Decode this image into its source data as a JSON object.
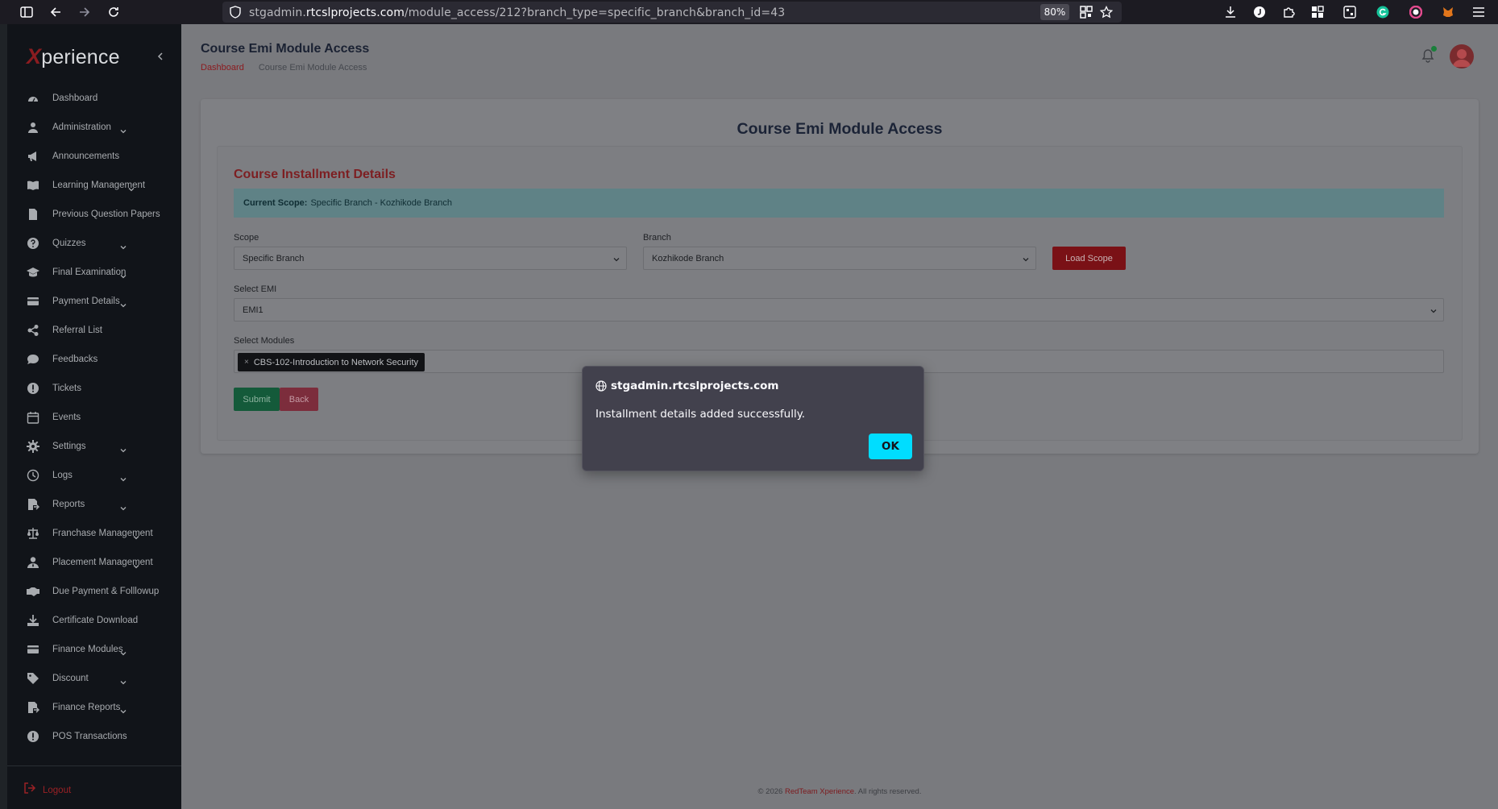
{
  "browser": {
    "url_prefix": "stgadmin.",
    "url_domain": "rtcslprojects.com",
    "url_path": "/module_access/212?branch_type=specific_branch&branch_id=43",
    "zoom": "80%"
  },
  "sidebar": {
    "logo_x": "X",
    "logo_rest": "perience",
    "items": [
      {
        "label": "Dashboard",
        "icon": "dashboard-icon",
        "has_caret": false
      },
      {
        "label": "Administration",
        "icon": "user-icon",
        "has_caret": true
      },
      {
        "label": "Announcements",
        "icon": "megaphone-icon",
        "has_caret": false
      },
      {
        "label": "Learning Management",
        "icon": "book-icon",
        "has_caret": true
      },
      {
        "label": "Previous Question Papers",
        "icon": "file-icon",
        "has_caret": false
      },
      {
        "label": "Quizzes",
        "icon": "question-icon",
        "has_caret": true
      },
      {
        "label": "Final Examination",
        "icon": "graduation-cap-icon",
        "has_caret": true
      },
      {
        "label": "Payment Details",
        "icon": "credit-card-icon",
        "has_caret": true
      },
      {
        "label": "Referral List",
        "icon": "share-icon",
        "has_caret": false
      },
      {
        "label": "Feedbacks",
        "icon": "comment-icon",
        "has_caret": false
      },
      {
        "label": "Tickets",
        "icon": "alert-icon",
        "has_caret": false
      },
      {
        "label": "Events",
        "icon": "calendar-icon",
        "has_caret": false
      },
      {
        "label": "Settings",
        "icon": "gear-icon",
        "has_caret": true
      },
      {
        "label": "Logs",
        "icon": "clock-icon",
        "has_caret": true
      },
      {
        "label": "Reports",
        "icon": "report-icon",
        "has_caret": true
      },
      {
        "label": "Franchase Management",
        "icon": "scale-icon",
        "has_caret": true
      },
      {
        "label": "Placement Management",
        "icon": "user-tie-icon",
        "has_caret": true
      },
      {
        "label": "Due Payment & Folllowup",
        "icon": "handshake-icon",
        "has_caret": false
      },
      {
        "label": "Certificate Download",
        "icon": "download-icon",
        "has_caret": false
      },
      {
        "label": "Finance Modules",
        "icon": "credit-card-icon",
        "has_caret": true
      },
      {
        "label": "Discount",
        "icon": "tag-icon",
        "has_caret": true
      },
      {
        "label": "Finance Reports",
        "icon": "report-icon",
        "has_caret": true
      },
      {
        "label": "POS Transactions",
        "icon": "alert-icon",
        "has_caret": false
      }
    ],
    "logout_label": "Logout"
  },
  "header": {
    "title": "Course Emi Module Access",
    "breadcrumb": {
      "home": "Dashboard",
      "current": "Course Emi Module Access"
    }
  },
  "main": {
    "card_title": "Course Emi Module Access",
    "section_title": "Course Installment Details",
    "scope_banner": {
      "label": "Current Scope:",
      "value": "Specific Branch - Kozhikode Branch"
    },
    "scope_label": "Scope",
    "scope_value": "Specific Branch",
    "branch_label": "Branch",
    "branch_value": "Kozhikode Branch",
    "load_scope_label": "Load Scope",
    "emi_label": "Select EMI",
    "emi_value": "EMI1",
    "modules_label": "Select Modules",
    "selected_modules": [
      "CBS-102-Introduction to Network Security"
    ],
    "remove_glyph": "×",
    "submit_label": "Submit",
    "back_label": "Back"
  },
  "footer": {
    "prefix": "© 2026 ",
    "brand": "RedTeam Xperience",
    "suffix": ". All rights reserved."
  },
  "dialog": {
    "origin": "stgadmin.rtcslprojects.com",
    "message": "Installment details added successfully.",
    "ok_label": "OK"
  },
  "colors": {
    "accent_red": "#8c1a1e",
    "ok_button": "#00ddff",
    "sidebar_bg": "#111419"
  }
}
